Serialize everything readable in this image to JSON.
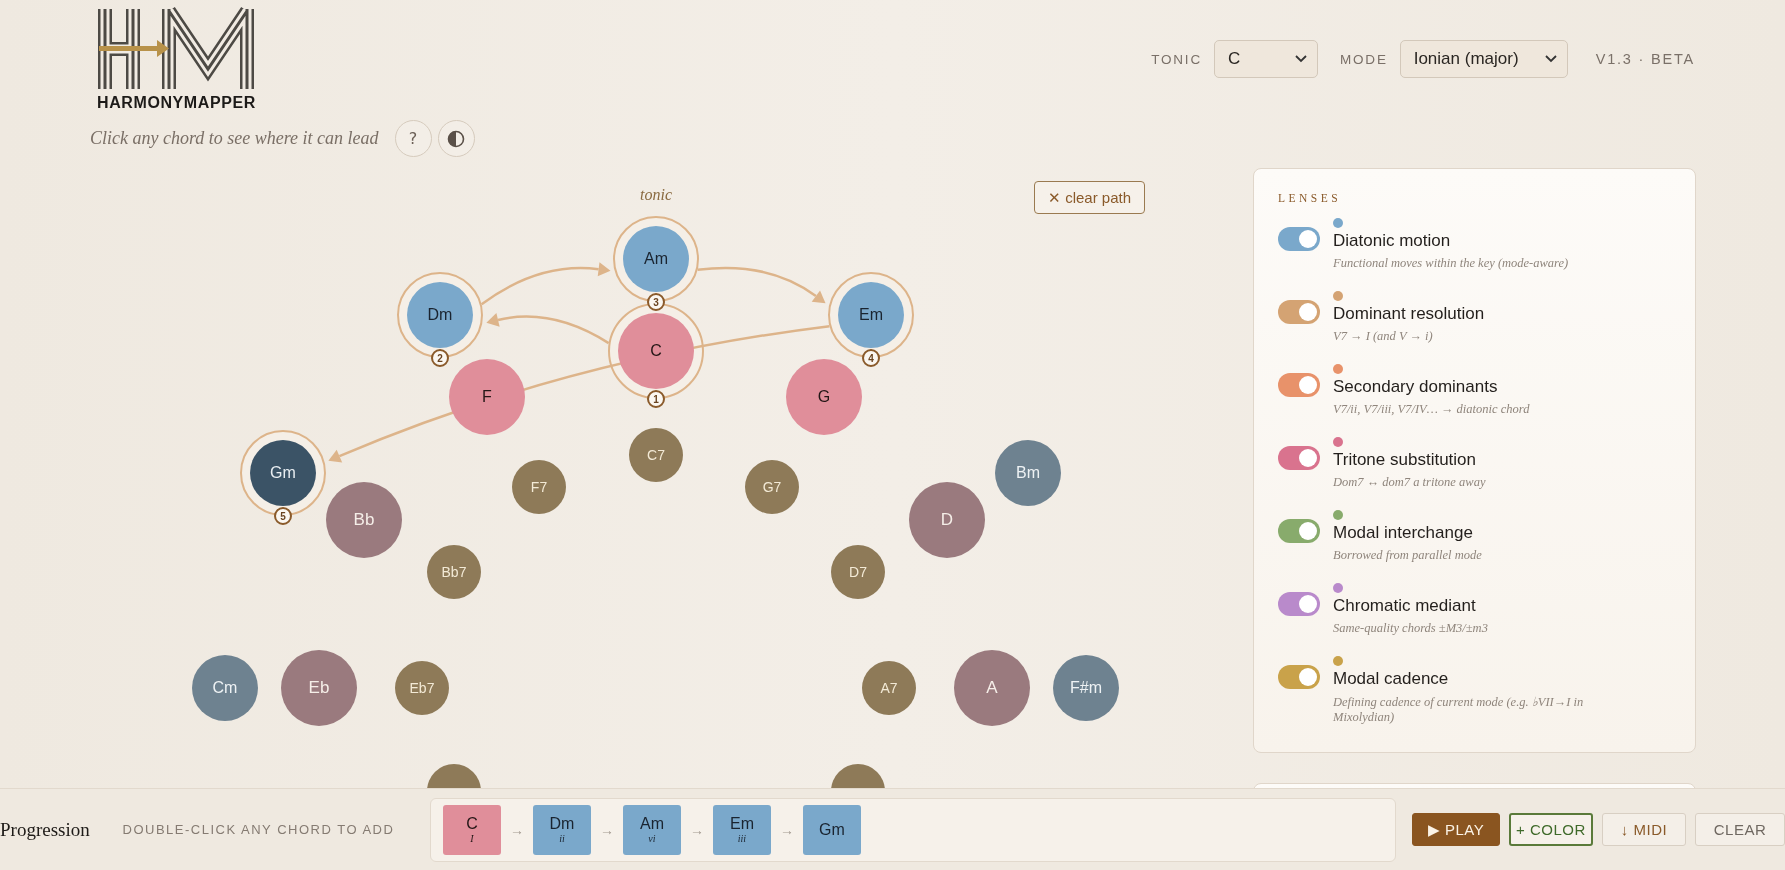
{
  "header": {
    "logo_text": "HARMONYMAPPER",
    "tagline": "Click any chord to see where it can lead",
    "help_button": "?"
  },
  "controls": {
    "tonic_label": "TONIC",
    "tonic_value": "C",
    "mode_label": "MODE",
    "mode_value": "Ionian (major)",
    "version": "V1.3 · BETA"
  },
  "graph": {
    "tonic_label": "tonic",
    "clear_button": "✕ clear path",
    "nodes": [
      {
        "label": "Am",
        "kind": "diatonic_minor",
        "selected": false,
        "step": "3"
      },
      {
        "label": "Dm",
        "kind": "diatonic_minor",
        "selected": false,
        "step": "2"
      },
      {
        "label": "F",
        "kind": "diatonic_major",
        "selected": false
      },
      {
        "label": "C",
        "kind": "diatonic_major",
        "selected": false,
        "step": "1"
      },
      {
        "label": "Em",
        "kind": "diatonic_minor",
        "selected": false,
        "step": "4"
      },
      {
        "label": "G",
        "kind": "diatonic_major",
        "selected": false
      },
      {
        "label": "Gm",
        "kind": "borrowed_minor",
        "selected": true,
        "step": "5"
      },
      {
        "label": "Bb",
        "kind": "borrowed_major",
        "selected": false
      },
      {
        "label": "F7",
        "kind": "dom7",
        "selected": false
      },
      {
        "label": "C7",
        "kind": "dom7",
        "selected": false
      },
      {
        "label": "G7",
        "kind": "dom7",
        "selected": false
      },
      {
        "label": "D",
        "kind": "borrowed_major",
        "selected": false
      },
      {
        "label": "Bm",
        "kind": "borrowed_minor",
        "selected": false
      },
      {
        "label": "Bb7",
        "kind": "dom7",
        "selected": false
      },
      {
        "label": "D7",
        "kind": "dom7",
        "selected": false
      },
      {
        "label": "Cm",
        "kind": "borrowed_minor",
        "selected": false
      },
      {
        "label": "Eb",
        "kind": "borrowed_major",
        "selected": false
      },
      {
        "label": "Eb7",
        "kind": "dom7",
        "selected": false
      },
      {
        "label": "A7",
        "kind": "dom7",
        "selected": false
      },
      {
        "label": "A",
        "kind": "borrowed_major",
        "selected": false
      },
      {
        "label": "F#m",
        "kind": "borrowed_minor",
        "selected": false
      },
      {
        "kind": "dom7",
        "selected": false
      },
      {
        "kind": "dom7",
        "selected": false
      }
    ]
  },
  "lenses": {
    "title": "LENSES",
    "items": [
      {
        "name": "Diatonic motion",
        "description": "Functional moves within the key (mode-aware)",
        "color": "#7aa8cb",
        "on": true
      },
      {
        "name": "Dominant resolution",
        "description": "V7 → I (and V → i)",
        "color": "#d4a373",
        "on": true
      },
      {
        "name": "Secondary dominants",
        "description": "V7/ii, V7/iii, V7/IV… → diatonic chord",
        "color": "#e8926a",
        "on": true
      },
      {
        "name": "Tritone substitution",
        "description": "Dom7 ↔ dom7 a tritone away",
        "color": "#d9738e",
        "on": true
      },
      {
        "name": "Modal interchange",
        "description": "Borrowed from parallel mode",
        "color": "#88ab6c",
        "on": true
      },
      {
        "name": "Chromatic mediant",
        "description": "Same-quality chords ±M3/±m3",
        "color": "#b98acb",
        "on": true
      },
      {
        "name": "Modal cadence",
        "description": "Defining cadence of current mode (e.g. ♭VII→I in Mixolydian)",
        "color": "#c9a24a",
        "on": true
      }
    ]
  },
  "progression": {
    "label": "Progression",
    "hint": "DOUBLE-CLICK ANY CHORD TO ADD",
    "chips": [
      {
        "chord": "C",
        "numeral": "I",
        "kind": "diatonic_major"
      },
      {
        "arrow": "→",
        "chord": "Dm",
        "numeral": "ii",
        "kind": "diatonic_minor"
      },
      {
        "arrow": "→",
        "chord": "Am",
        "numeral": "vi",
        "kind": "diatonic_minor"
      },
      {
        "arrow": "→",
        "chord": "Em",
        "numeral": "iii",
        "kind": "diatonic_minor"
      },
      {
        "arrow": "→",
        "chord": "Gm",
        "kind": "diatonic_minor"
      }
    ],
    "buttons": [
      {
        "label": "▶ PLAY",
        "kind": "primary"
      },
      {
        "label": "+ COLOR",
        "kind": "accent"
      },
      {
        "label": "↓ MIDI",
        "kind": "plain"
      },
      {
        "label": "CLEAR",
        "kind": "muted"
      }
    ]
  }
}
